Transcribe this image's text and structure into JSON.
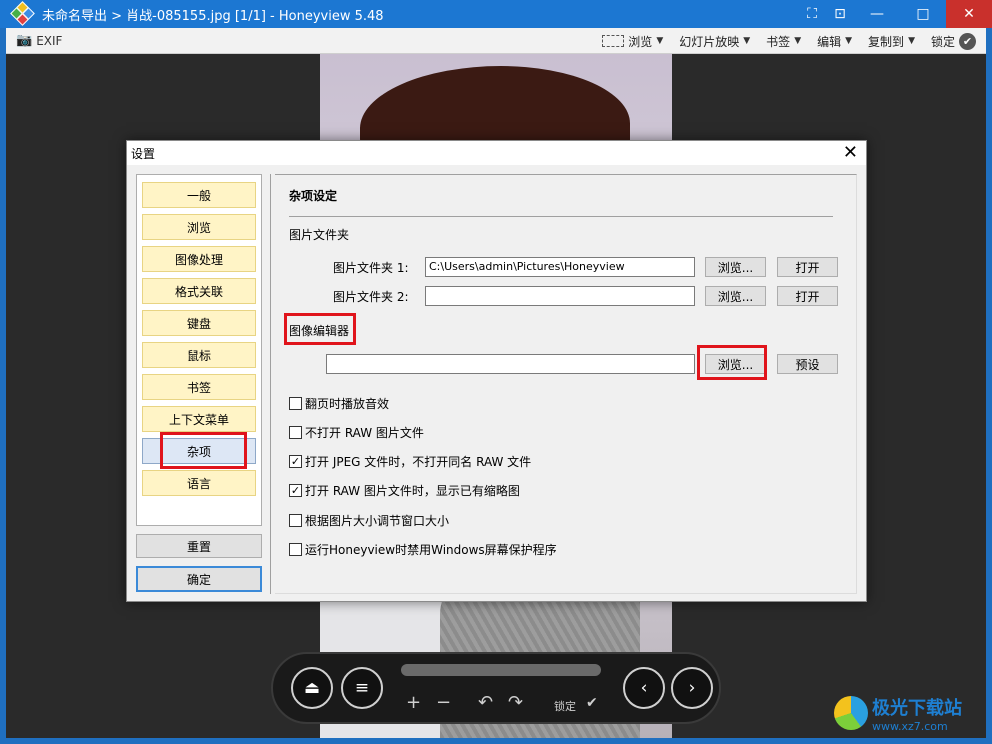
{
  "window": {
    "title": "未命名导出 > 肖战-085155.jpg [1/1] - Honeyview 5.48",
    "controls": {
      "restore": "⛶",
      "minimize": "—",
      "maximize": "□",
      "close": "✕"
    }
  },
  "toolbar": {
    "exif_label": "EXIF",
    "browse_label": "浏览",
    "slideshow_label": "幻灯片放映",
    "bookmark_label": "书签",
    "edit_label": "编辑",
    "copyto_label": "复制到",
    "lock_label": "锁定"
  },
  "dialog": {
    "title": "设置",
    "nav": [
      "一般",
      "浏览",
      "图像处理",
      "格式关联",
      "键盘",
      "鼠标",
      "书签",
      "上下文菜单",
      "杂项",
      "语言"
    ],
    "active_nav": "杂项",
    "reset_label": "重置",
    "ok_label": "确定",
    "section_title": "杂项设定",
    "picture_folder_heading": "图片文件夹",
    "folder1_label": "图片文件夹 1:",
    "folder1_value": "C:\\Users\\admin\\Pictures\\Honeyview",
    "folder2_label": "图片文件夹 2:",
    "folder2_value": "",
    "browse_btn": "浏览...",
    "open_btn": "打开",
    "image_editor_heading": "图像编辑器",
    "editor_value": "",
    "preset_btn": "预设",
    "options": [
      {
        "label": "翻页时播放音效",
        "checked": false
      },
      {
        "label": "不打开 RAW 图片文件",
        "checked": false
      },
      {
        "label": "打开 JPEG 文件时，不打开同名 RAW 文件",
        "checked": true
      },
      {
        "label": "打开 RAW 图片文件时，显示已有缩略图",
        "checked": true
      },
      {
        "label": "根据图片大小调节窗口大小",
        "checked": false
      },
      {
        "label": "运行Honeyview时禁用Windows屏幕保护程序",
        "checked": false
      }
    ]
  },
  "controls": {
    "lock_label": "锁定",
    "zoom_in": "+",
    "zoom_out": "−",
    "rotate_left": "↶",
    "rotate_right": "↷"
  },
  "watermark": {
    "name": "极光下载站",
    "url": "www.xz7.com"
  }
}
